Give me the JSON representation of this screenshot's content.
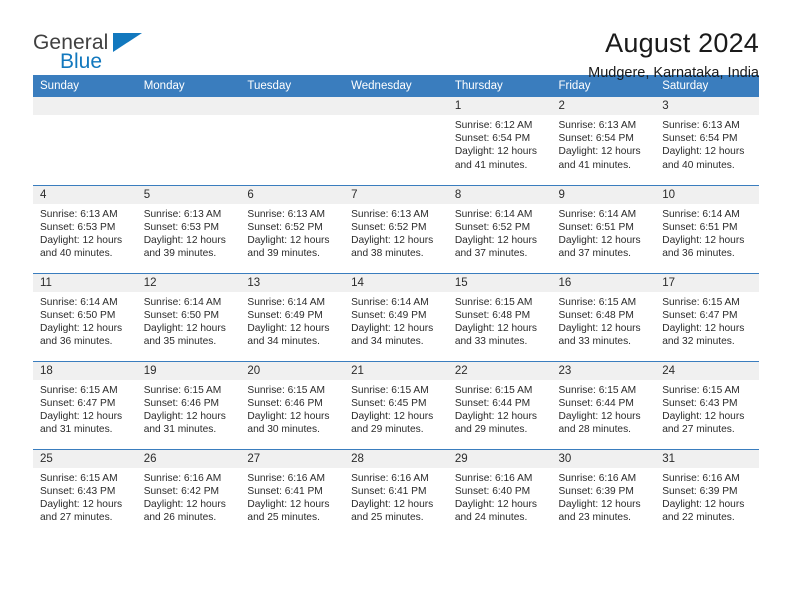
{
  "brand": {
    "name_part1": "General",
    "name_part2": "Blue",
    "triangle_icon": "triangle-logo-icon",
    "accent_color": "#1278be"
  },
  "header": {
    "month_title": "August 2024",
    "location": "Mudgere, Karnataka, India"
  },
  "theme": {
    "header_band": "#3a7dbe",
    "daynum_band": "#f0f0f0",
    "text": "#2b2b2b"
  },
  "weekday_headers": [
    "Sunday",
    "Monday",
    "Tuesday",
    "Wednesday",
    "Thursday",
    "Friday",
    "Saturday"
  ],
  "labels": {
    "sunrise_prefix": "Sunrise:",
    "sunset_prefix": "Sunset:",
    "daylight_prefix": "Daylight:"
  },
  "weeks": [
    [
      {
        "day": "",
        "blank": true
      },
      {
        "day": "",
        "blank": true
      },
      {
        "day": "",
        "blank": true
      },
      {
        "day": "",
        "blank": true
      },
      {
        "day": "1",
        "sunrise": "Sunrise: 6:12 AM",
        "sunset": "Sunset: 6:54 PM",
        "daylight1": "Daylight: 12 hours",
        "daylight2": "and 41 minutes."
      },
      {
        "day": "2",
        "sunrise": "Sunrise: 6:13 AM",
        "sunset": "Sunset: 6:54 PM",
        "daylight1": "Daylight: 12 hours",
        "daylight2": "and 41 minutes."
      },
      {
        "day": "3",
        "sunrise": "Sunrise: 6:13 AM",
        "sunset": "Sunset: 6:54 PM",
        "daylight1": "Daylight: 12 hours",
        "daylight2": "and 40 minutes."
      }
    ],
    [
      {
        "day": "4",
        "sunrise": "Sunrise: 6:13 AM",
        "sunset": "Sunset: 6:53 PM",
        "daylight1": "Daylight: 12 hours",
        "daylight2": "and 40 minutes."
      },
      {
        "day": "5",
        "sunrise": "Sunrise: 6:13 AM",
        "sunset": "Sunset: 6:53 PM",
        "daylight1": "Daylight: 12 hours",
        "daylight2": "and 39 minutes."
      },
      {
        "day": "6",
        "sunrise": "Sunrise: 6:13 AM",
        "sunset": "Sunset: 6:52 PM",
        "daylight1": "Daylight: 12 hours",
        "daylight2": "and 39 minutes."
      },
      {
        "day": "7",
        "sunrise": "Sunrise: 6:13 AM",
        "sunset": "Sunset: 6:52 PM",
        "daylight1": "Daylight: 12 hours",
        "daylight2": "and 38 minutes."
      },
      {
        "day": "8",
        "sunrise": "Sunrise: 6:14 AM",
        "sunset": "Sunset: 6:52 PM",
        "daylight1": "Daylight: 12 hours",
        "daylight2": "and 37 minutes."
      },
      {
        "day": "9",
        "sunrise": "Sunrise: 6:14 AM",
        "sunset": "Sunset: 6:51 PM",
        "daylight1": "Daylight: 12 hours",
        "daylight2": "and 37 minutes."
      },
      {
        "day": "10",
        "sunrise": "Sunrise: 6:14 AM",
        "sunset": "Sunset: 6:51 PM",
        "daylight1": "Daylight: 12 hours",
        "daylight2": "and 36 minutes."
      }
    ],
    [
      {
        "day": "11",
        "sunrise": "Sunrise: 6:14 AM",
        "sunset": "Sunset: 6:50 PM",
        "daylight1": "Daylight: 12 hours",
        "daylight2": "and 36 minutes."
      },
      {
        "day": "12",
        "sunrise": "Sunrise: 6:14 AM",
        "sunset": "Sunset: 6:50 PM",
        "daylight1": "Daylight: 12 hours",
        "daylight2": "and 35 minutes."
      },
      {
        "day": "13",
        "sunrise": "Sunrise: 6:14 AM",
        "sunset": "Sunset: 6:49 PM",
        "daylight1": "Daylight: 12 hours",
        "daylight2": "and 34 minutes."
      },
      {
        "day": "14",
        "sunrise": "Sunrise: 6:14 AM",
        "sunset": "Sunset: 6:49 PM",
        "daylight1": "Daylight: 12 hours",
        "daylight2": "and 34 minutes."
      },
      {
        "day": "15",
        "sunrise": "Sunrise: 6:15 AM",
        "sunset": "Sunset: 6:48 PM",
        "daylight1": "Daylight: 12 hours",
        "daylight2": "and 33 minutes."
      },
      {
        "day": "16",
        "sunrise": "Sunrise: 6:15 AM",
        "sunset": "Sunset: 6:48 PM",
        "daylight1": "Daylight: 12 hours",
        "daylight2": "and 33 minutes."
      },
      {
        "day": "17",
        "sunrise": "Sunrise: 6:15 AM",
        "sunset": "Sunset: 6:47 PM",
        "daylight1": "Daylight: 12 hours",
        "daylight2": "and 32 minutes."
      }
    ],
    [
      {
        "day": "18",
        "sunrise": "Sunrise: 6:15 AM",
        "sunset": "Sunset: 6:47 PM",
        "daylight1": "Daylight: 12 hours",
        "daylight2": "and 31 minutes."
      },
      {
        "day": "19",
        "sunrise": "Sunrise: 6:15 AM",
        "sunset": "Sunset: 6:46 PM",
        "daylight1": "Daylight: 12 hours",
        "daylight2": "and 31 minutes."
      },
      {
        "day": "20",
        "sunrise": "Sunrise: 6:15 AM",
        "sunset": "Sunset: 6:46 PM",
        "daylight1": "Daylight: 12 hours",
        "daylight2": "and 30 minutes."
      },
      {
        "day": "21",
        "sunrise": "Sunrise: 6:15 AM",
        "sunset": "Sunset: 6:45 PM",
        "daylight1": "Daylight: 12 hours",
        "daylight2": "and 29 minutes."
      },
      {
        "day": "22",
        "sunrise": "Sunrise: 6:15 AM",
        "sunset": "Sunset: 6:44 PM",
        "daylight1": "Daylight: 12 hours",
        "daylight2": "and 29 minutes."
      },
      {
        "day": "23",
        "sunrise": "Sunrise: 6:15 AM",
        "sunset": "Sunset: 6:44 PM",
        "daylight1": "Daylight: 12 hours",
        "daylight2": "and 28 minutes."
      },
      {
        "day": "24",
        "sunrise": "Sunrise: 6:15 AM",
        "sunset": "Sunset: 6:43 PM",
        "daylight1": "Daylight: 12 hours",
        "daylight2": "and 27 minutes."
      }
    ],
    [
      {
        "day": "25",
        "sunrise": "Sunrise: 6:15 AM",
        "sunset": "Sunset: 6:43 PM",
        "daylight1": "Daylight: 12 hours",
        "daylight2": "and 27 minutes."
      },
      {
        "day": "26",
        "sunrise": "Sunrise: 6:16 AM",
        "sunset": "Sunset: 6:42 PM",
        "daylight1": "Daylight: 12 hours",
        "daylight2": "and 26 minutes."
      },
      {
        "day": "27",
        "sunrise": "Sunrise: 6:16 AM",
        "sunset": "Sunset: 6:41 PM",
        "daylight1": "Daylight: 12 hours",
        "daylight2": "and 25 minutes."
      },
      {
        "day": "28",
        "sunrise": "Sunrise: 6:16 AM",
        "sunset": "Sunset: 6:41 PM",
        "daylight1": "Daylight: 12 hours",
        "daylight2": "and 25 minutes."
      },
      {
        "day": "29",
        "sunrise": "Sunrise: 6:16 AM",
        "sunset": "Sunset: 6:40 PM",
        "daylight1": "Daylight: 12 hours",
        "daylight2": "and 24 minutes."
      },
      {
        "day": "30",
        "sunrise": "Sunrise: 6:16 AM",
        "sunset": "Sunset: 6:39 PM",
        "daylight1": "Daylight: 12 hours",
        "daylight2": "and 23 minutes."
      },
      {
        "day": "31",
        "sunrise": "Sunrise: 6:16 AM",
        "sunset": "Sunset: 6:39 PM",
        "daylight1": "Daylight: 12 hours",
        "daylight2": "and 22 minutes."
      }
    ]
  ]
}
